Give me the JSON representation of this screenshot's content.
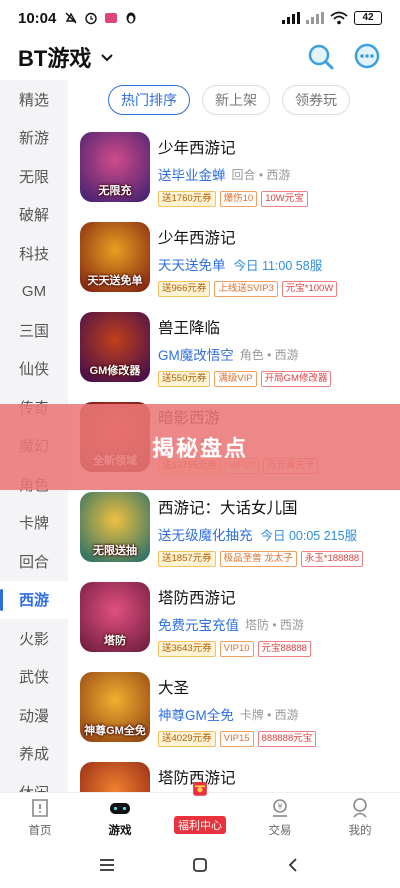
{
  "status": {
    "time": "10:04",
    "battery": "42"
  },
  "header": {
    "title": "BT游戏"
  },
  "sidebar": {
    "items": [
      {
        "label": "精选"
      },
      {
        "label": "新游"
      },
      {
        "label": "无限"
      },
      {
        "label": "破解"
      },
      {
        "label": "科技"
      },
      {
        "label": "GM"
      },
      {
        "label": "三国"
      },
      {
        "label": "仙侠"
      },
      {
        "label": "传奇"
      },
      {
        "label": "魔幻"
      },
      {
        "label": "角色"
      },
      {
        "label": "卡牌"
      },
      {
        "label": "回合"
      },
      {
        "label": "西游"
      },
      {
        "label": "火影"
      },
      {
        "label": "武侠"
      },
      {
        "label": "动漫"
      },
      {
        "label": "养成"
      },
      {
        "label": "休闲"
      }
    ],
    "active_index": 13
  },
  "filters": {
    "items": [
      {
        "label": "热门排序"
      },
      {
        "label": "新上架"
      },
      {
        "label": "领券玩"
      }
    ]
  },
  "games": [
    {
      "name": "少年西游记",
      "promo": "送毕业金蝉",
      "meta": "回合 • 西游",
      "open": "",
      "cover_text": "无限充",
      "cover_colors": [
        "#3a1f6e",
        "#d14b8a"
      ],
      "tags": [
        "送1760元券",
        "爆伤10",
        "10W元宝"
      ]
    },
    {
      "name": "少年西游记",
      "promo": "天天送免单",
      "meta": "",
      "open": "今日 11:00 58服",
      "cover_text": "天天送免单",
      "cover_colors": [
        "#7a1a10",
        "#e8a020"
      ],
      "tags": [
        "送966元券",
        "上线送SVIP3",
        "元宝*100W"
      ]
    },
    {
      "name": "兽王降临",
      "promo": "GM魔改悟空",
      "meta": "角色 • 西游",
      "open": "",
      "cover_text": "GM修改器",
      "cover_colors": [
        "#3a0a50",
        "#c0401a"
      ],
      "tags": [
        "送550元券",
        "满级VIP",
        "开局GM修改器"
      ]
    },
    {
      "name": "暗影西游",
      "promo": "",
      "meta": "角色 • 西游",
      "open": "",
      "cover_text": "全新领域",
      "cover_colors": [
        "#5a1010",
        "#d04030"
      ],
      "tags": [
        "送13755元券",
        "VIP20",
        "万元真充卡"
      ]
    },
    {
      "name": "西游记：大话女儿国",
      "promo": "送无级魔化抽充",
      "meta": "",
      "open": "今日 00:05 215服",
      "cover_text": "无限送抽",
      "cover_colors": [
        "#1a6a6a",
        "#f0c040"
      ],
      "tags": [
        "送1857元券",
        "极品圣兽 龙太子",
        "永玉*188888"
      ]
    },
    {
      "name": "塔防西游记",
      "promo": "免费元宝充值",
      "meta": "塔防 • 西游",
      "open": "",
      "cover_text": "塔防",
      "cover_colors": [
        "#6a1a3a",
        "#e05080"
      ],
      "tags": [
        "送3643元券",
        "VIP10",
        "元宝88888"
      ]
    },
    {
      "name": "大圣",
      "promo": "神尊GM全免",
      "meta": "卡牌 • 西游",
      "open": "",
      "cover_text": "神尊GM全免",
      "cover_colors": [
        "#8a3a10",
        "#f0b030"
      ],
      "tags": [
        "送4029元券",
        "VIP15",
        "888888元宝"
      ]
    },
    {
      "name": "塔防西游记",
      "promo": "",
      "meta": "",
      "open": "",
      "cover_text": "",
      "cover_colors": [
        "#8a2010",
        "#f08030"
      ],
      "tags": []
    }
  ],
  "banner": {
    "text": "揭秘盘点"
  },
  "bottom_nav": {
    "items": [
      {
        "label": "首页",
        "icon": "home-icon"
      },
      {
        "label": "游戏",
        "icon": "gamepad-icon"
      },
      {
        "label": "福利中心",
        "icon": "gift-icon"
      },
      {
        "label": "交易",
        "icon": "trade-icon"
      },
      {
        "label": "我的",
        "icon": "profile-icon"
      }
    ],
    "active_index": 1
  },
  "colors": {
    "accent": "#2f6fe0",
    "banner": "#eb7878",
    "welfare": "#e8323c"
  }
}
